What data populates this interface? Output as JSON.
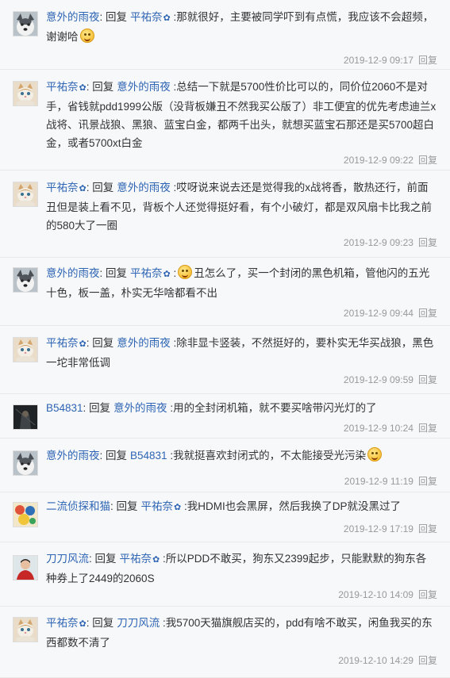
{
  "reply_word": "回复",
  "reply_button": "回复",
  "comments": [
    {
      "user": "意外的雨夜",
      "user_flower": false,
      "target": "平祐奈",
      "target_flower": true,
      "text_before": "那就很好，主要被同学吓到有点慌，我应该不会超频，谢谢哈",
      "emoji_after": true,
      "time": "2019-12-9 09:17",
      "avatar": "husky"
    },
    {
      "user": "平祐奈",
      "user_flower": true,
      "target": "意外的雨夜",
      "target_flower": false,
      "text_before": "总结一下就是5700性价比可以的，同价位2060不是对手，省钱就pdd1999公版（没背板嫌丑不然我买公版了）非工便宜的优先考虑迪兰x战将、讯景战狼、黑狼、蓝宝白金，都两千出头，就想买蓝宝石那还是买5700超白金，或者5700xt白金",
      "time": "2019-12-9 09:22",
      "avatar": "cat"
    },
    {
      "user": "平祐奈",
      "user_flower": true,
      "target": "意外的雨夜",
      "target_flower": false,
      "text_before": "哎呀说来说去还是觉得我的x战将香，散热还行，前面丑但是装上看不见，背板个人还觉得挺好看，有个小破灯，都是双风扇卡比我之前的580大了一圈",
      "time": "2019-12-9 09:23",
      "avatar": "cat"
    },
    {
      "user": "意外的雨夜",
      "user_flower": false,
      "target": "平祐奈",
      "target_flower": true,
      "emoji_before": true,
      "text_before": "丑怎么了，买一个封闭的黑色机箱，管他闪的五光十色，板一盖，朴实无华啥都看不出",
      "time": "2019-12-9 09:44",
      "avatar": "husky"
    },
    {
      "user": "平祐奈",
      "user_flower": true,
      "target": "意外的雨夜",
      "target_flower": false,
      "text_before": "除非显卡竖装，不然挺好的，要朴实无华买战狼，黑色一坨非常低调",
      "time": "2019-12-9 09:59",
      "avatar": "cat"
    },
    {
      "user": "B54831",
      "user_flower": false,
      "target": "意外的雨夜",
      "target_flower": false,
      "text_before": "用的全封闭机箱，就不要买啥带闪光灯的了",
      "time": "2019-12-9 10:24",
      "avatar": "dark"
    },
    {
      "user": "意外的雨夜",
      "user_flower": false,
      "target": "B54831",
      "target_flower": false,
      "text_before": "我就挺喜欢封闭式的，不太能接受光污染",
      "emoji_after": true,
      "time": "2019-12-9 11:19",
      "avatar": "husky"
    },
    {
      "user": "二流侦探和猫",
      "user_flower": false,
      "target": "平祐奈",
      "target_flower": true,
      "text_before": "我HDMI也会黑屏，然后我换了DP就没黑过了",
      "time": "2019-12-9 17:19",
      "avatar": "colorful"
    },
    {
      "user": "刀刀风流",
      "user_flower": false,
      "target": "平祐奈",
      "target_flower": true,
      "text_before": "所以PDD不敢买，狗东又2399起步，只能默默的狗东各种券上了2449的2060S",
      "time": "2019-12-10 14:09",
      "avatar": "person"
    },
    {
      "user": "平祐奈",
      "user_flower": true,
      "target": "刀刀风流",
      "target_flower": false,
      "text_before": "我5700天猫旗舰店买的，pdd有啥不敢买，闲鱼我买的东西都数不清了",
      "time": "2019-12-10 14:29",
      "avatar": "cat"
    }
  ]
}
